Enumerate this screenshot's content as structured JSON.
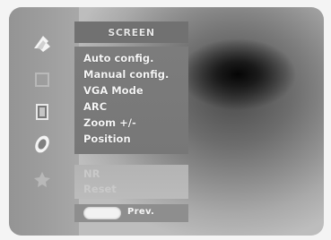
{
  "menu": {
    "header": "SCREEN",
    "items": [
      "Auto config.",
      "Manual config.",
      "VGA Mode",
      "ARC",
      "Zoom +/-",
      "Position"
    ],
    "lower_items": [
      "NR",
      "Reset"
    ]
  },
  "footer": {
    "prev_label": "Prev."
  },
  "icons": [
    "screen-menu-icon",
    "picture-menu-icon",
    "sound-menu-icon",
    "time-menu-icon",
    "special-menu-icon"
  ]
}
